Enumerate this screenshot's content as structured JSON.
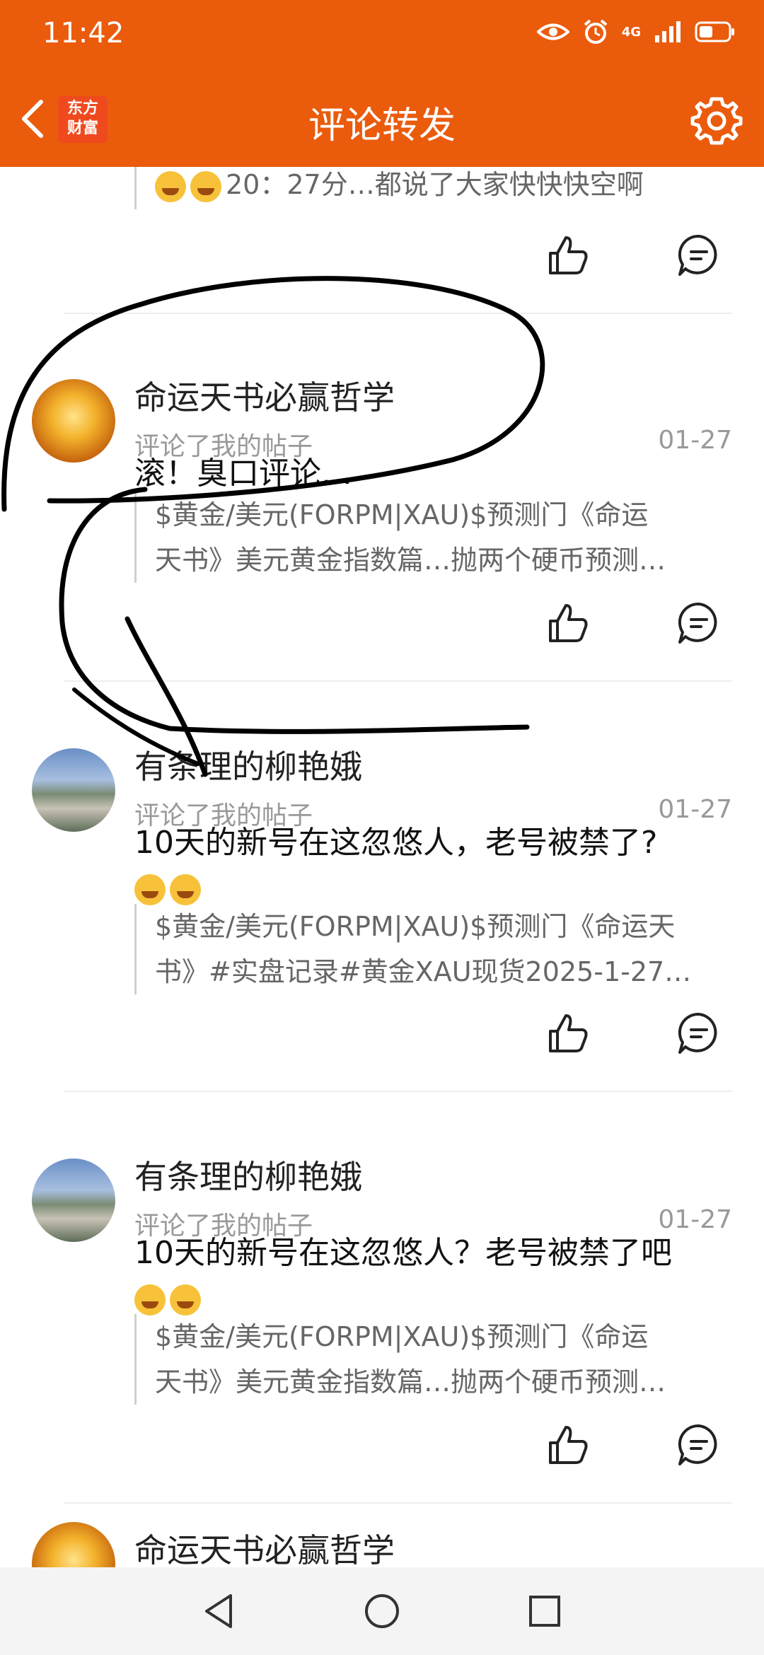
{
  "status": {
    "time": "11:42",
    "network": "4G"
  },
  "header": {
    "title": "评论转发",
    "logo_line1": "东方",
    "logo_line2": "财富"
  },
  "feed": {
    "partial_top": {
      "quote": "20：27分…都说了大家快快快空啊"
    },
    "items": [
      {
        "username": "命运天书必赢哲学",
        "action": "评论了我的帖子",
        "date": "01-27",
        "comment": "滚！臭口评论…",
        "quote_line1": "$黄金/美元(FORPM|XAU)$预测门《命运",
        "quote_line2": "天书》美元黄金指数篇…抛两个硬币预测…"
      },
      {
        "username": "有条理的柳艳娥",
        "action": "评论了我的帖子",
        "date": "01-27",
        "comment": "10天的新号在这忽悠人，老号被禁了?",
        "quote_line1": "$黄金/美元(FORPM|XAU)$预测门《命运天",
        "quote_line2": "书》#实盘记录#黄金XAU现货2025-1-27…"
      },
      {
        "username": "有条理的柳艳娥",
        "action": "评论了我的帖子",
        "date": "01-27",
        "comment": "10天的新号在这忽悠人？老号被禁了吧",
        "quote_line1": "$黄金/美元(FORPM|XAU)$预测门《命运",
        "quote_line2": "天书》美元黄金指数篇…抛两个硬币预测…"
      },
      {
        "username": "命运天书必赢哲学"
      }
    ]
  },
  "colors": {
    "brand": "#ea5b0c",
    "secondary_text": "#999999"
  }
}
